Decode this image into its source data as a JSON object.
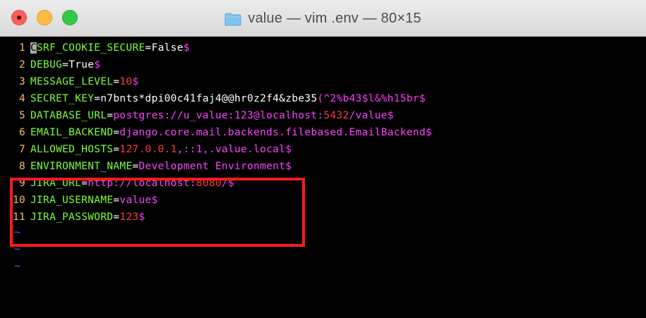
{
  "window": {
    "title": "value — vim .env — 80×15",
    "folder_icon": "folder-icon",
    "colors": {
      "close": "#fc605c",
      "minimize": "#fdbc40",
      "zoom": "#34c84a"
    }
  },
  "editor": {
    "lines": [
      {
        "num": "1",
        "key": "CSRF_COOKIE_SECURE",
        "eq": "=",
        "value": "False",
        "eol": "$"
      },
      {
        "num": "2",
        "key": "DEBUG",
        "eq": "=",
        "value": "True",
        "eol": "$"
      },
      {
        "num": "3",
        "key": "MESSAGE_LEVEL",
        "eq": "=",
        "value": "10",
        "eol": "$"
      },
      {
        "num": "4",
        "key": "SECRET_KEY",
        "eq": "=",
        "value_a": "n7bnts*dpi00c41faj4@@hr0z2f4&zbe35",
        "value_b": "(^2%b43$l&%h15br",
        "eol": "$"
      },
      {
        "num": "5",
        "key": "DATABASE_URL",
        "eq": "=",
        "value_a": "postgres://u_value:123@localhost:",
        "value_num": "5432",
        "value_b": "/value",
        "eol": "$"
      },
      {
        "num": "6",
        "key": "EMAIL_BACKEND",
        "eq": "=",
        "value": "django.core.mail.backends.filebased.EmailBackend",
        "eol": "$"
      },
      {
        "num": "7",
        "key": "ALLOWED_HOSTS",
        "eq": "=",
        "value_a": "127.0.0.1",
        "value_b": ",::1,.value.local",
        "eol": "$"
      },
      {
        "num": "8",
        "key": "ENVIRONMENT_NAME",
        "eq": "=",
        "value": "Development Environment",
        "eol": "$"
      },
      {
        "num": "9",
        "key": "JIRA_URL",
        "eq": "=",
        "value_a": "http://localhost:",
        "value_num": "8080",
        "value_b": "/",
        "eol": "$"
      },
      {
        "num": "10",
        "key": "JIRA_USERNAME",
        "eq": "=",
        "value": "value",
        "eol": "$"
      },
      {
        "num": "11",
        "key": "JIRA_PASSWORD",
        "eq": "=",
        "value": "123",
        "eol": "$"
      }
    ],
    "cursor_char": "C",
    "empty_line": "~"
  }
}
